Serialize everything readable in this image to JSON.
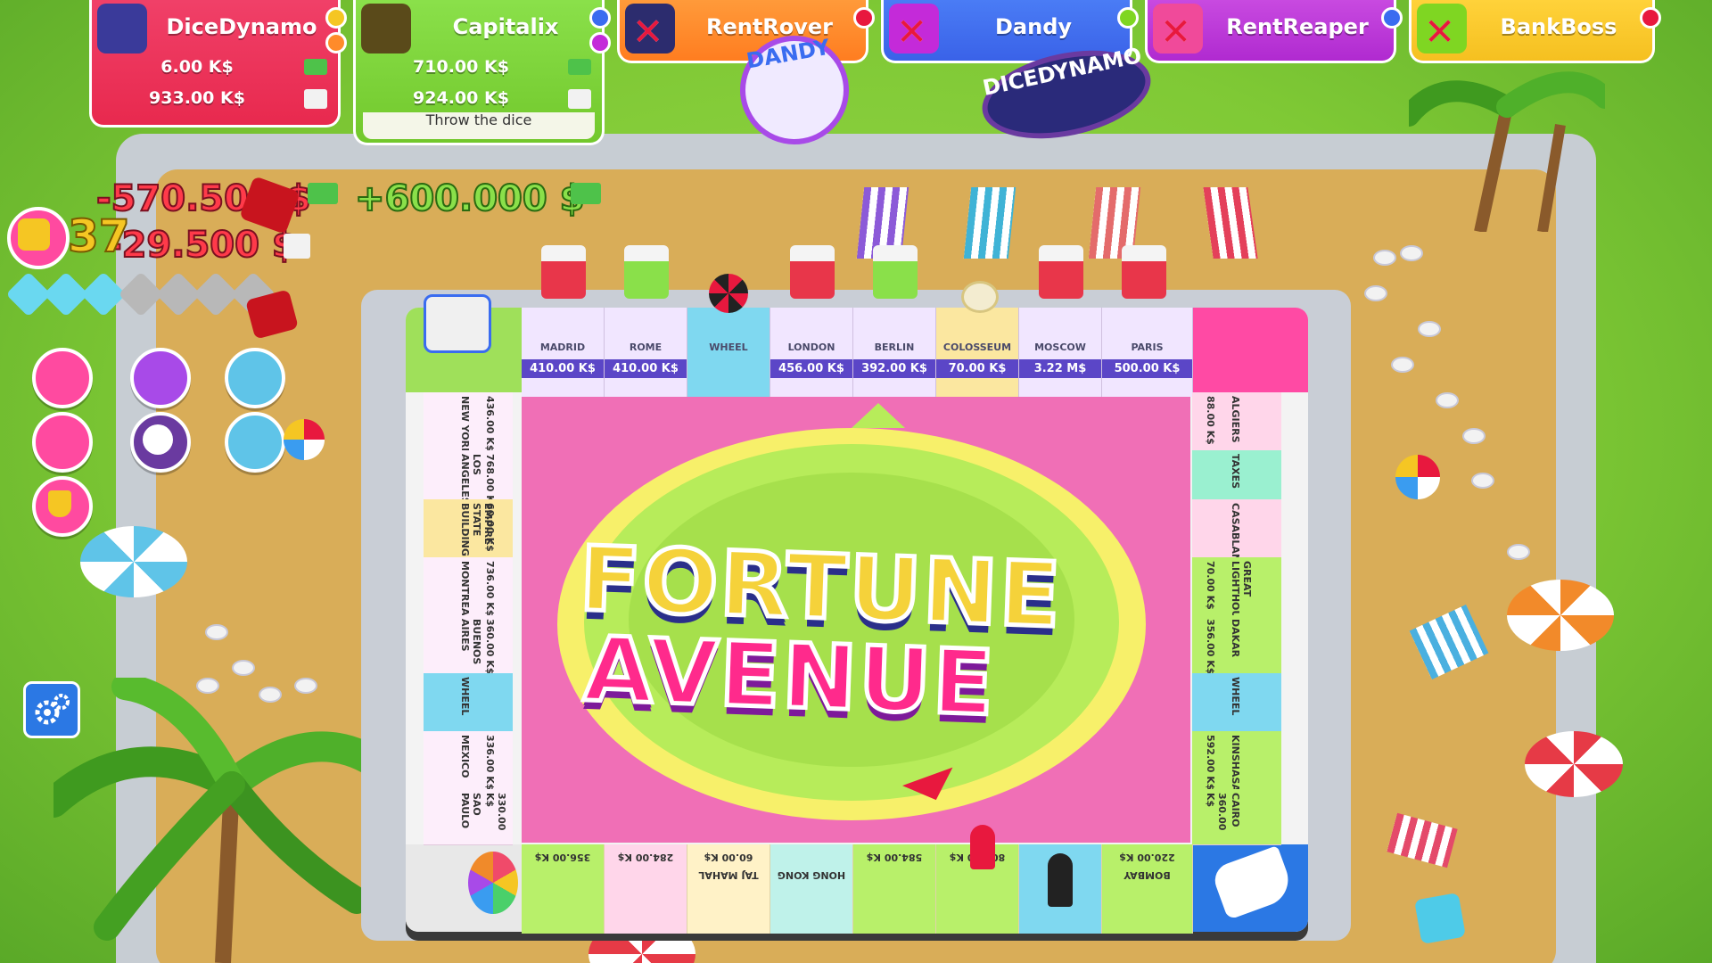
{
  "players": [
    {
      "name": "DiceDynamo",
      "cash": "6.00 K$",
      "bank": "933.00 K$",
      "color": "#ef2f55",
      "eliminated": false
    },
    {
      "name": "Capitalix",
      "cash": "710.00 K$",
      "bank": "924.00 K$",
      "color": "#7fd622",
      "status": "Throw the dice",
      "eliminated": false
    },
    {
      "name": "RentRover",
      "color": "#ff8b2a",
      "eliminated": true
    },
    {
      "name": "Dandy",
      "color": "#3a6cf0",
      "eliminated": true
    },
    {
      "name": "RentReaper",
      "color": "#c42ad9",
      "eliminated": true
    },
    {
      "name": "BankBoss",
      "color": "#f5c623",
      "eliminated": true
    }
  ],
  "stamps": [
    "DANDY",
    "DICEDYNAMO"
  ],
  "hud": {
    "loss": "-570.500 $",
    "gain": "+600.000 $",
    "bank_loss": "-29.500 $",
    "turn_count": "37"
  },
  "logo": {
    "line1": "FORTUNE",
    "line2": "AVENUE"
  },
  "top_row": [
    {
      "name": "MADRID",
      "price": "410.00 K$"
    },
    {
      "name": "ROME",
      "price": "410.00 K$"
    },
    {
      "name": "WHEEL",
      "price": ""
    },
    {
      "name": "LONDON",
      "price": "456.00 K$"
    },
    {
      "name": "BERLIN",
      "price": "392.00 K$"
    },
    {
      "name": "COLOSSEUM",
      "price": "70.00 K$"
    },
    {
      "name": "MOSCOW",
      "price": "3.22 M$"
    },
    {
      "name": "PARIS",
      "price": "500.00 K$"
    }
  ],
  "left_column": [
    {
      "name": "NEW YORK",
      "price": "436.00 K$"
    },
    {
      "name": "LOS ANGELES",
      "price": "768.00 K$"
    },
    {
      "name": "EMPIRE STATE BUILDING",
      "price": "60.00 K$"
    },
    {
      "name": "MONTREAL",
      "price": "736.00 K$"
    },
    {
      "name": "BUENOS AIRES",
      "price": "360.00 K$"
    },
    {
      "name": "WHEEL",
      "price": ""
    },
    {
      "name": "MEXICO",
      "price": "336.00 K$"
    },
    {
      "name": "SAO PAULO",
      "price": "330.00 K$"
    }
  ],
  "right_column": [
    {
      "name": "ALGIERS",
      "price": "88.00 K$"
    },
    {
      "name": "TAXES",
      "price": ""
    },
    {
      "name": "CASABLANCA",
      "price": ""
    },
    {
      "name": "GREAT LIGHTHOUSE",
      "price": "70.00 K$"
    },
    {
      "name": "DAKAR",
      "price": "356.00 K$"
    },
    {
      "name": "WHEEL",
      "price": ""
    },
    {
      "name": "KINSHASA",
      "price": "592.00 K$"
    },
    {
      "name": "CAIRO",
      "price": "360.00 K$"
    }
  ],
  "bottom_row": [
    {
      "name": "",
      "price": "356.00 K$"
    },
    {
      "name": "",
      "price": "284.00 K$"
    },
    {
      "name": "TAJ MAHAL",
      "price": "60.00 K$"
    },
    {
      "name": "HONG KONG",
      "price": ""
    },
    {
      "name": "",
      "price": "584.00 K$"
    },
    {
      "name": "",
      "price": "800.00 K$"
    },
    {
      "name": "",
      "price": ""
    },
    {
      "name": "BOMBAY",
      "price": "220.00 K$"
    }
  ],
  "icons": {
    "settings": "gear-icon",
    "dice": "dice-icon",
    "trophy": "trophy-icon"
  }
}
